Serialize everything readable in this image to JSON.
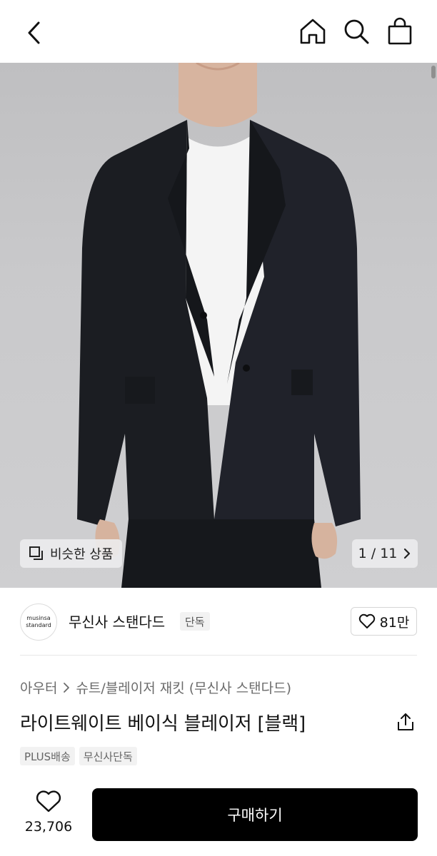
{
  "header": {
    "back_icon": "chevron-left-icon",
    "icons": [
      "home-icon",
      "search-icon",
      "shopping-bag-icon"
    ]
  },
  "gallery": {
    "similar_label": "비슷한 상품",
    "page_current": "1",
    "page_total": "11",
    "page_text": "1 / 11"
  },
  "brand": {
    "logo_line1": "musinsa",
    "logo_line2": "standard",
    "name": "무신사 스탠다드",
    "badge": "단독",
    "likes": "81만"
  },
  "product": {
    "breadcrumb_category": "아우터",
    "breadcrumb_sub": "슈트/블레이저 재킷 (무신사 스탠다드)",
    "title": "라이트웨이트 베이식 블레이저 [블랙]",
    "tags": [
      "PLUS배송",
      "무신사단독"
    ]
  },
  "bottom": {
    "like_count": "23,706",
    "buy_label": "구매하기"
  },
  "colors": {
    "primary": "#000000",
    "background": "#ffffff",
    "muted_text": "#6b6b6b"
  }
}
